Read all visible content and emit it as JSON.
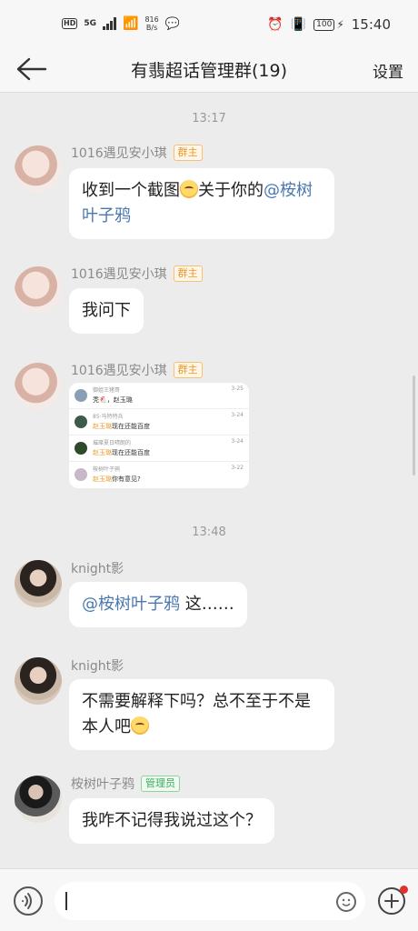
{
  "status_bar": {
    "hd": "HD",
    "net": "5G",
    "speed_value": "816",
    "speed_unit": "B/s",
    "battery": "100",
    "time": "15:40",
    "icons": [
      "signal-icon",
      "wifi-icon",
      "wechat-icon",
      "alarm-icon",
      "vibrate-icon",
      "charging-icon"
    ]
  },
  "header": {
    "back_icon": "back-arrow-icon",
    "title": "有翡超话管理群(19)",
    "settings_label": "设置"
  },
  "chat": {
    "messages": [
      {
        "type": "time",
        "text": "13:17"
      },
      {
        "type": "text",
        "sender": "1016遇见安小琪",
        "badge": "群主",
        "text_before": "收到一个截图",
        "emoji": "emoji-sweat-icon",
        "text_after": "关于你的",
        "mention": "@桉树叶子鸦"
      },
      {
        "type": "text",
        "sender": "1016遇见安小琪",
        "badge": "群主",
        "text": "我问下"
      },
      {
        "type": "image",
        "sender": "1016遇见安小琪",
        "badge": "群主",
        "screenshot_rows": [
          {
            "name": "御姐王猪哥",
            "text": "秃🐔，赵玉璐",
            "date": "3-25"
          },
          {
            "name": "85·马特特兵",
            "text_hl": "赵玉璐",
            "text": "现在还能百度",
            "date": "3-24"
          },
          {
            "name": "璀璨夏日晴朗的",
            "text_hl": "赵玉璐",
            "text": "现在还能百度",
            "date": "3-24"
          },
          {
            "name": "桉树叶子鸦",
            "text_hl": "赵玉璐",
            "text": "你有意见?",
            "date": "3-22"
          }
        ]
      },
      {
        "type": "time",
        "text": "13:48"
      },
      {
        "type": "text",
        "sender": "knight影",
        "mention": "@桉树叶子鸦",
        "text_after": " 这……"
      },
      {
        "type": "text",
        "sender": "knight影",
        "text_before": "不需要解释下吗？总不至于不是本人吧",
        "emoji": "emoji-thinking-icon"
      },
      {
        "type": "text",
        "sender": "桉树叶子鸦",
        "badge": "管理员",
        "text": "我咋不记得我说过这个？"
      }
    ]
  },
  "input_bar": {
    "voice_icon": "voice-icon",
    "emoji_icon": "emoji-icon",
    "plus_icon": "plus-icon"
  }
}
